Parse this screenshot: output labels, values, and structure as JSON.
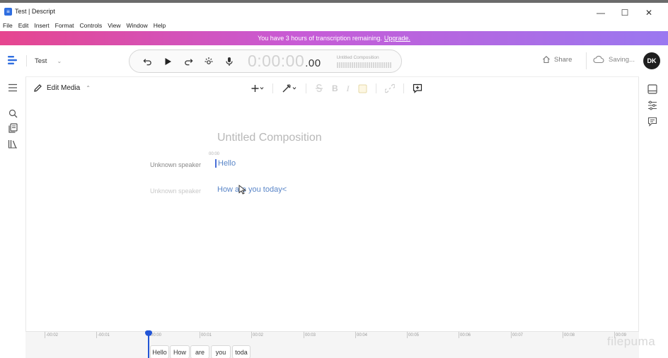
{
  "window": {
    "title": "Test | Descript",
    "minimize": "—",
    "maximize": "☐",
    "close": "✕"
  },
  "menu": [
    "File",
    "Edit",
    "Insert",
    "Format",
    "Controls",
    "View",
    "Window",
    "Help"
  ],
  "banner": {
    "text": "You have 3 hours of transcription remaining.",
    "link": "Upgrade."
  },
  "topbar": {
    "project_name": "Test",
    "timecode_main": "0:00:00",
    "timecode_ms": ".00",
    "composition_name": "Untitled Composition",
    "share_label": "Share",
    "saving_label": "Saving...",
    "avatar_initials": "DK"
  },
  "editor": {
    "mode_label": "Edit Media",
    "doc_title": "Untitled Composition",
    "timestamp": "00:00",
    "paragraphs": [
      {
        "speaker": "Unknown speaker",
        "text": "Hello"
      },
      {
        "speaker": "Unknown speaker",
        "text": "How are you today<"
      }
    ]
  },
  "timeline": {
    "ticks": [
      "-00:02",
      "-00:01",
      "00:00",
      "00:01",
      "00:02",
      "00:03",
      "00:04",
      "00:05",
      "00:06",
      "00:07",
      "00:08",
      "00:09"
    ],
    "words": [
      "Hello",
      "How",
      "are",
      "you",
      "toda"
    ]
  },
  "watermark": "filepuma",
  "colors": {
    "accent": "#2356d6",
    "banner_start": "#e6468f",
    "banner_end": "#9a78f0",
    "transcript_text": "#5a86c8"
  }
}
